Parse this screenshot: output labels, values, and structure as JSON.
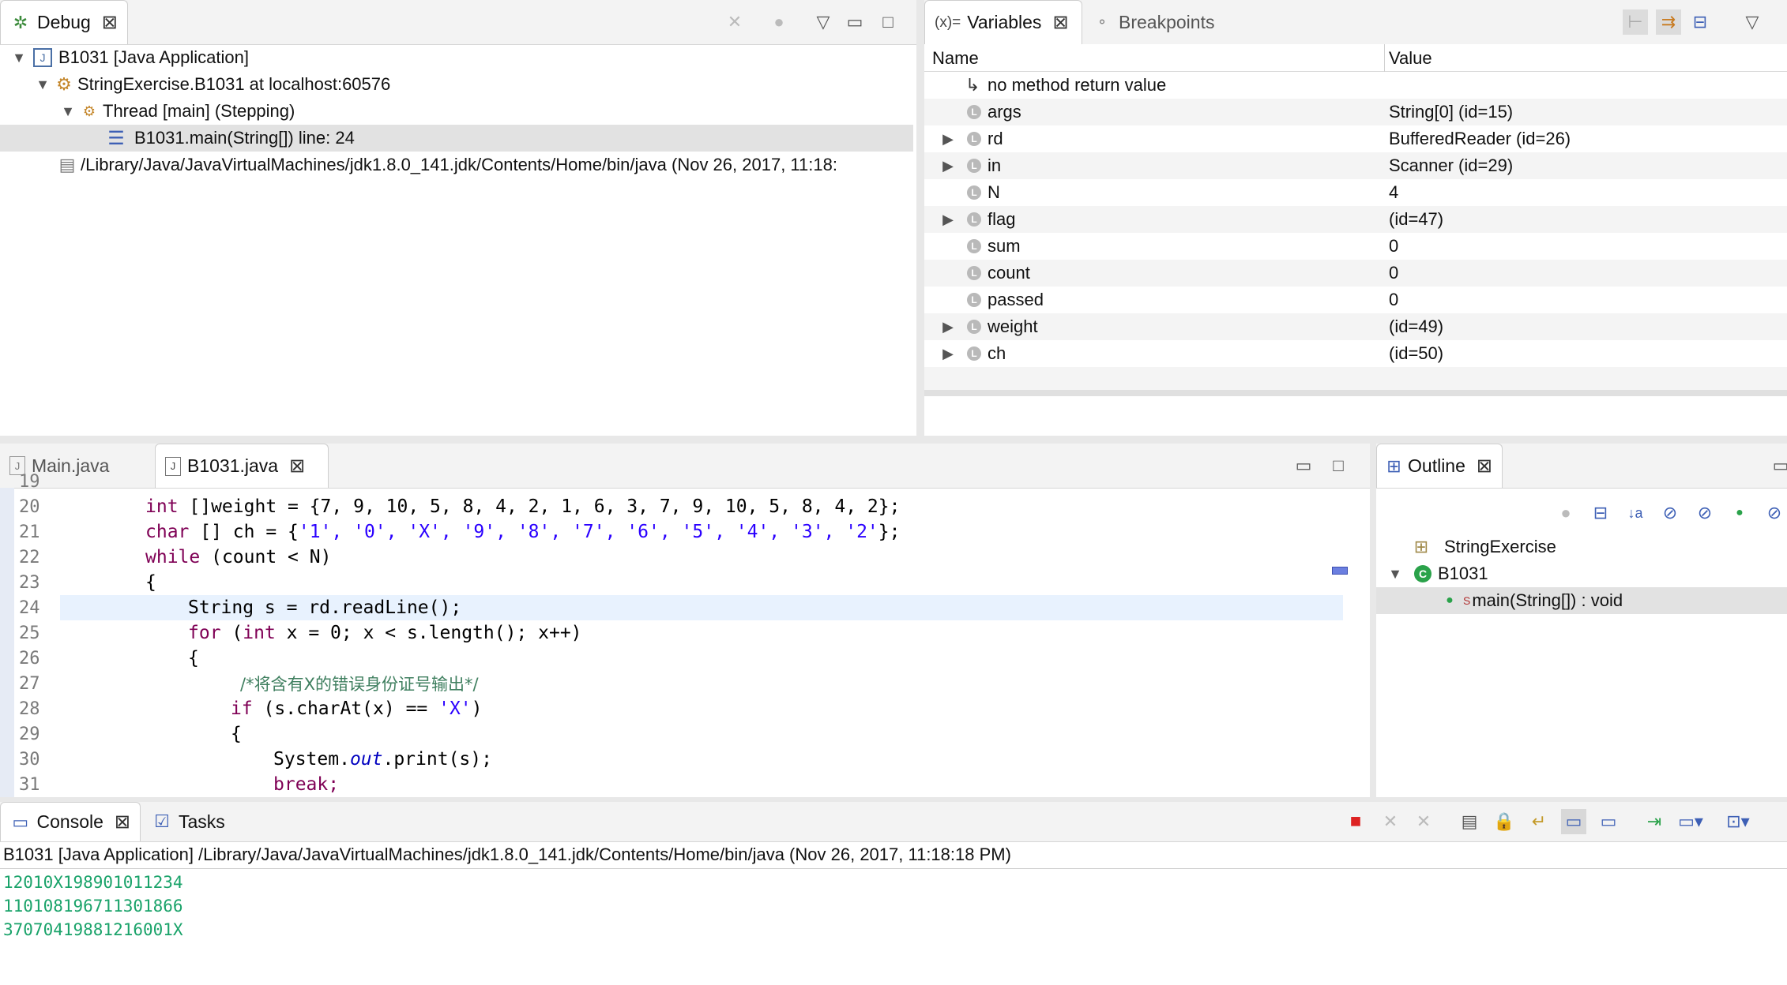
{
  "debug": {
    "tab_label": "Debug",
    "tree": [
      {
        "text": "B1031 [Java Application]"
      },
      {
        "text": "StringExercise.B1031 at localhost:60576"
      },
      {
        "text": "Thread [main] (Stepping)"
      },
      {
        "text": "B1031.main(String[]) line: 24"
      },
      {
        "text": "/Library/Java/JavaVirtualMachines/jdk1.8.0_141.jdk/Contents/Home/bin/java (Nov 26, 2017, 11:18:"
      }
    ]
  },
  "variables": {
    "tab_label": "Variables",
    "tab_prefix": "(x)=",
    "breakpoints_label": "Breakpoints",
    "col_name": "Name",
    "col_value": "Value",
    "rows": [
      {
        "name": "no method return value",
        "value": ""
      },
      {
        "name": "args",
        "value": "String[0]  (id=15)"
      },
      {
        "name": "rd",
        "value": "BufferedReader  (id=26)"
      },
      {
        "name": "in",
        "value": "Scanner  (id=29)"
      },
      {
        "name": "N",
        "value": "4"
      },
      {
        "name": "flag",
        "value": "(id=47)"
      },
      {
        "name": "sum",
        "value": "0"
      },
      {
        "name": "count",
        "value": "0"
      },
      {
        "name": "passed",
        "value": "0"
      },
      {
        "name": "weight",
        "value": "(id=49)"
      },
      {
        "name": "ch",
        "value": "(id=50)"
      }
    ]
  },
  "editor": {
    "tabs": [
      {
        "label": "Main.java"
      },
      {
        "label": "B1031.java"
      }
    ],
    "line_numbers": [
      "19",
      "20",
      "21",
      "22",
      "23",
      "24",
      "25",
      "26",
      "27",
      "28",
      "29",
      "30",
      "31"
    ],
    "line20": {
      "kw": "int",
      "text": " []weight = {7, 9, 10, 5, 8, 4, 2, 1, 6, 3, 7, 9, 10, 5, 8, 4, 2};"
    },
    "line21": {
      "kw": "char",
      "p1": " [] ch = {",
      "chars": "'1', '0', 'X', '9', '8', '7', '6', '5', '4', '3', '2'",
      "p2": "};"
    },
    "line22": {
      "kw": "while",
      "text": " (count < N)"
    },
    "line23": {
      "text": "{"
    },
    "line24": {
      "text": "String s = rd.readLine();"
    },
    "line25": {
      "kw": "for",
      "p1": " (",
      "kw2": "int",
      "p2": " x = 0; x < s.length(); x++)"
    },
    "line26": {
      "text": "{"
    },
    "line27": {
      "text": "/*将含有X的错误身份证号输出*/"
    },
    "line28": {
      "kw": "if",
      "p1": " (s.charAt(x) == ",
      "str": "'X'",
      "p2": ")"
    },
    "line29": {
      "text": "{"
    },
    "line30": {
      "p1": "System.",
      "fld": "out",
      "p2": ".print(s);"
    },
    "line31": {
      "text": "break;"
    }
  },
  "outline": {
    "tab_label": "Outline",
    "items": [
      {
        "text": "StringExercise"
      },
      {
        "text": "B1031"
      },
      {
        "text": "main(String[]) : void",
        "modifier": "S"
      }
    ]
  },
  "console": {
    "tab_label": "Console",
    "tasks_label": "Tasks",
    "header": "B1031 [Java Application] /Library/Java/JavaVirtualMachines/jdk1.8.0_141.jdk/Contents/Home/bin/java (Nov 26, 2017, 11:18:18 PM)",
    "output": [
      "12010X198901011234",
      "110108196711301866",
      "37070419881216001X"
    ]
  }
}
